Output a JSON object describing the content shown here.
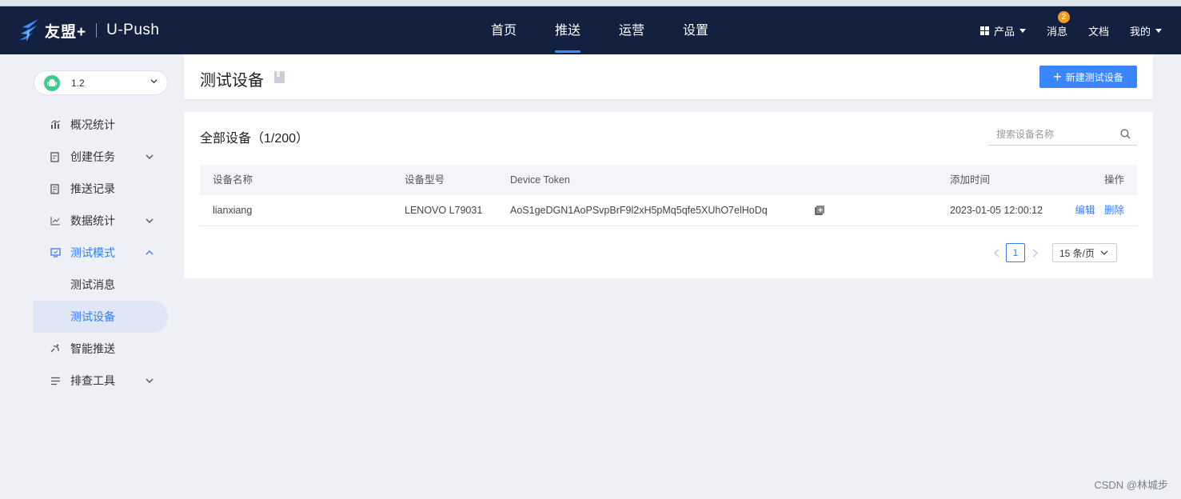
{
  "header": {
    "brand": "友盟+",
    "product": "U-Push",
    "nav": [
      "首页",
      "推送",
      "运营",
      "设置"
    ],
    "active_nav": "推送",
    "right": {
      "product_menu": "产品",
      "messages": "消息",
      "message_badge": "2",
      "docs": "文档",
      "mine": "我的"
    }
  },
  "sidebar": {
    "app_version": "1.2",
    "app_icon": "android-icon",
    "items": [
      {
        "label": "概况统计",
        "icon": "bar-chart-icon"
      },
      {
        "label": "创建任务",
        "icon": "task-icon"
      },
      {
        "label": "推送记录",
        "icon": "record-icon"
      },
      {
        "label": "数据统计",
        "icon": "line-chart-icon"
      },
      {
        "label": "测试模式",
        "icon": "monitor-icon"
      },
      {
        "label": "测试消息"
      },
      {
        "label": "测试设备"
      },
      {
        "label": "智能推送",
        "icon": "satellite-icon"
      },
      {
        "label": "排查工具",
        "icon": "list-icon"
      }
    ]
  },
  "page": {
    "title": "测试设备",
    "new_button": "新建测试设备"
  },
  "devices": {
    "title": "全部设备（1/200）",
    "search_placeholder": "搜索设备名称",
    "columns": [
      "设备名称",
      "设备型号",
      "Device Token",
      "添加时间",
      "操作"
    ],
    "rows": [
      {
        "name": "lianxiang",
        "model": "LENOVO L79031",
        "token": "AoS1geDGN1AoPSvpBrF9l2xH5pMq5qfe5XUhO7elHoDq",
        "added": "2023-01-05 12:00:12",
        "edit": "编辑",
        "delete": "删除"
      }
    ],
    "pagination": {
      "current_page": "1",
      "page_size": "15 条/页"
    }
  },
  "watermark": "CSDN @林城步",
  "colors": {
    "nav_bg": "#13203f",
    "primary": "#3a86ff",
    "link": "#3a7cf2",
    "page_bg": "#eef0f5"
  }
}
